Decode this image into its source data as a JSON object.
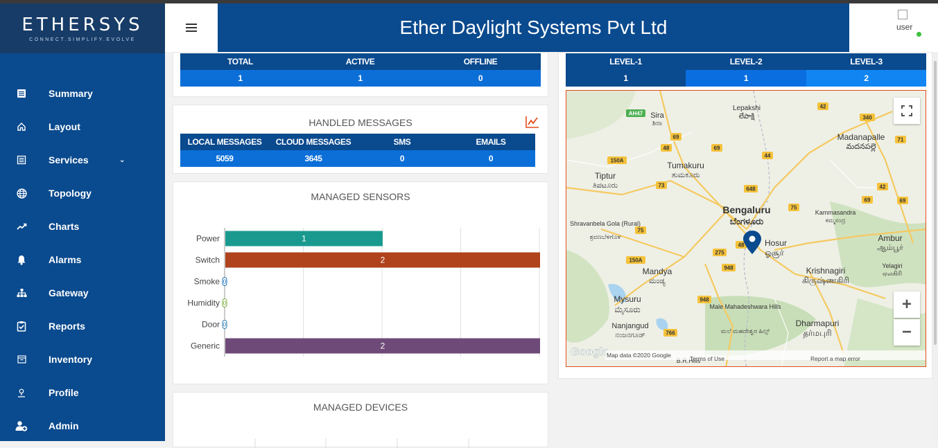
{
  "brand": {
    "name": "ETHERSYS",
    "tagline": "CONNECT.SIMPLIFY.EVOLVE"
  },
  "header": {
    "title": "Ether Daylight Systems Pvt Ltd",
    "user": "user"
  },
  "sidebar": {
    "items": [
      {
        "label": "Summary",
        "icon": "summary-icon"
      },
      {
        "label": "Layout",
        "icon": "home-icon"
      },
      {
        "label": "Services",
        "icon": "list-icon",
        "caret": "⌄"
      },
      {
        "label": "Topology",
        "icon": "globe-icon"
      },
      {
        "label": "Charts",
        "icon": "trend-icon"
      },
      {
        "label": "Alarms",
        "icon": "bell-icon"
      },
      {
        "label": "Gateway",
        "icon": "sitemap-icon"
      },
      {
        "label": "Reports",
        "icon": "clipboard-check-icon"
      },
      {
        "label": "Inventory",
        "icon": "inventory-icon"
      },
      {
        "label": "Profile",
        "icon": "user-icon"
      },
      {
        "label": "Admin",
        "icon": "user-add-icon"
      }
    ]
  },
  "device_status": {
    "headers": [
      "TOTAL",
      "ACTIVE",
      "OFFLINE"
    ],
    "values": [
      "1",
      "1",
      "0"
    ]
  },
  "levels": {
    "headers": [
      "LEVEL-1",
      "LEVEL-2",
      "LEVEL-3"
    ],
    "values": [
      "1",
      "1",
      "2"
    ],
    "colors": [
      "#0c6fd8",
      "#0a6ee0",
      "#1185f2"
    ]
  },
  "handled_messages": {
    "title": "HANDLED MESSAGES",
    "headers": [
      "LOCAL MESSAGES",
      "CLOUD MESSAGES",
      "SMS",
      "EMAILS"
    ],
    "values": [
      "5059",
      "3645",
      "0",
      "0"
    ]
  },
  "managed_sensors": {
    "title": "MANAGED SENSORS"
  },
  "managed_devices": {
    "title": "MANAGED DEVICES"
  },
  "chart_data": {
    "type": "bar",
    "orientation": "horizontal",
    "categories": [
      "Power",
      "Switch",
      "Smoke",
      "Humidity",
      "Door",
      "Generic"
    ],
    "values": [
      1,
      2,
      0,
      0,
      0,
      2
    ],
    "colors": [
      "#1a9a8e",
      "#b0421c",
      "#1a6fb8",
      "#7aaa3a",
      "#2a7ab0",
      "#6e4a78"
    ],
    "xlim": [
      0,
      2
    ],
    "grid": true
  },
  "map": {
    "attribution_google": "Google",
    "map_data": "Map data ©2020 Google",
    "terms": "Terms of Use",
    "report": "Report a map error",
    "places": [
      {
        "name": "Bengaluru",
        "local": "ಬೆಂಗಳೂರು"
      },
      {
        "name": "Hosur",
        "local": "ஓசூர்"
      },
      {
        "name": "Tumakuru",
        "local": "ತುಮಕೂರು"
      },
      {
        "name": "Mysuru",
        "local": "ಮೈಸೂರು"
      },
      {
        "name": "Mandya",
        "local": "ಮಂಡ್ಯ"
      },
      {
        "name": "Krishnagiri",
        "local": "கிருஷ்ணகிரி"
      },
      {
        "name": "Dharmapuri",
        "local": "தர்மபுரி"
      },
      {
        "name": "Madanapalle",
        "local": "మదనపల్లె"
      },
      {
        "name": "Tiptur",
        "local": "ತಿಪಟೂರು"
      },
      {
        "name": "Sira",
        "local": "ಶಿರಾ"
      },
      {
        "name": "Lepakshi",
        "local": "లేపాక్షి"
      },
      {
        "name": "Ambur",
        "local": "ஆம்பூர்"
      },
      {
        "name": "Nanjangud",
        "local": "ನಂಜನಗೂಡ್"
      },
      {
        "name": "Kammasandra",
        "local": "ಕಮ್ಮಸಂದ್ರ"
      },
      {
        "name": "Shravanbela Gola (Rural)",
        "local": "ಶ್ರವಣಬೆಳಗೊಳ"
      },
      {
        "name": "Male Mahadeshwara Hills",
        "local": "ಮಲೆ ಮಹದೇಶ್ವರ ಹಿಲ್ಸ್"
      },
      {
        "name": "Yelagiri",
        "local": "ஏலகிரி"
      },
      {
        "name": "B.R.Hills",
        "local": ""
      }
    ],
    "road_badges": [
      "AH47",
      "42",
      "340",
      "69",
      "48",
      "69",
      "44",
      "71",
      "150A",
      "73",
      "648",
      "42",
      "69",
      "69",
      "75",
      "75",
      "48",
      "275",
      "150A",
      "948",
      "948",
      "766",
      "150A"
    ]
  }
}
